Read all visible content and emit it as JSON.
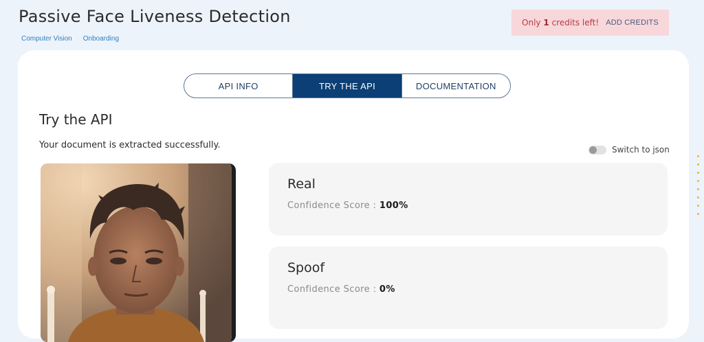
{
  "header": {
    "title": "Passive Face Liveness Detection",
    "breadcrumb": [
      "Computer Vision",
      "Onboarding"
    ]
  },
  "credits": {
    "prefix": "Only",
    "count": "1",
    "suffix": "credits left!",
    "add_label": "ADD CREDITS"
  },
  "tabs": [
    {
      "label": "API INFO",
      "active": false
    },
    {
      "label": "TRY THE API",
      "active": true
    },
    {
      "label": "DOCUMENTATION",
      "active": false
    }
  ],
  "main": {
    "section_title": "Try the API",
    "status_text": "Your document is extracted successfully.",
    "json_toggle_label": "Switch to json",
    "json_toggle_on": false
  },
  "results": [
    {
      "label": "Real",
      "score_label": "Confidence Score :",
      "score_value": "100%"
    },
    {
      "label": "Spoof",
      "score_label": "Confidence Score :",
      "score_value": "0%"
    }
  ],
  "colors": {
    "accent": "#0b3f75",
    "credits_bg": "#f8d7da",
    "credits_text": "#b63b43",
    "page_bg": "#edf3fb"
  }
}
